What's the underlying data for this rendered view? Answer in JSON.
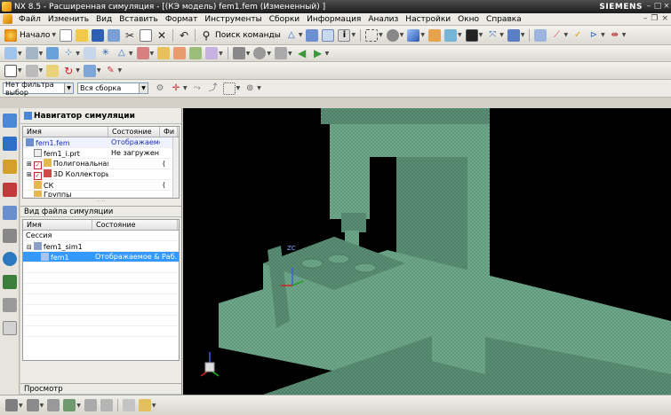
{
  "window": {
    "title": "NX 8.5 - Расширенная симуляция - [(КЭ модель) fem1.fem (Измененный) ]",
    "brand": "SIEMENS"
  },
  "menu": [
    "Файл",
    "Изменить",
    "Вид",
    "Вставить",
    "Формат",
    "Инструменты",
    "Сборки",
    "Информация",
    "Анализ",
    "Настройки",
    "Окно",
    "Справка"
  ],
  "toolbar": {
    "start_label": "Начало",
    "command_search_label": "Поиск команды",
    "filter_combo": "Нет фильтра выбор",
    "assembly_combo": "Вся сборка"
  },
  "sim_navigator": {
    "title": "Навигатор симуляции",
    "columns": [
      "Имя",
      "Состояние",
      "Фи"
    ],
    "rows": [
      {
        "name": "fem1.fem",
        "state": "Отображаемо...",
        "extra": ""
      },
      {
        "name": "fem1_i.prt",
        "state": "Не загружен",
        "extra": ""
      },
      {
        "name": "Полигональная ...",
        "state": "",
        "extra": "("
      },
      {
        "name": "3D Коллекторы",
        "state": "",
        "extra": ""
      },
      {
        "name": "СК",
        "state": "",
        "extra": "("
      },
      {
        "name": "Группы",
        "state": "",
        "extra": ""
      }
    ]
  },
  "file_view": {
    "title": "Вид файла симуляции",
    "columns": [
      "Имя",
      "Состояние"
    ],
    "rows": [
      {
        "name": "Сессия",
        "state": ""
      },
      {
        "name": "fem1_sim1",
        "state": ""
      },
      {
        "name": "fem1",
        "state": "Отображаемое & Раб..."
      }
    ]
  },
  "viewer_section": {
    "title": "Просмотр"
  },
  "viewport": {
    "triad_label_zc": "ZC",
    "mesh_color": "#6fa88b",
    "background": "#000000"
  }
}
